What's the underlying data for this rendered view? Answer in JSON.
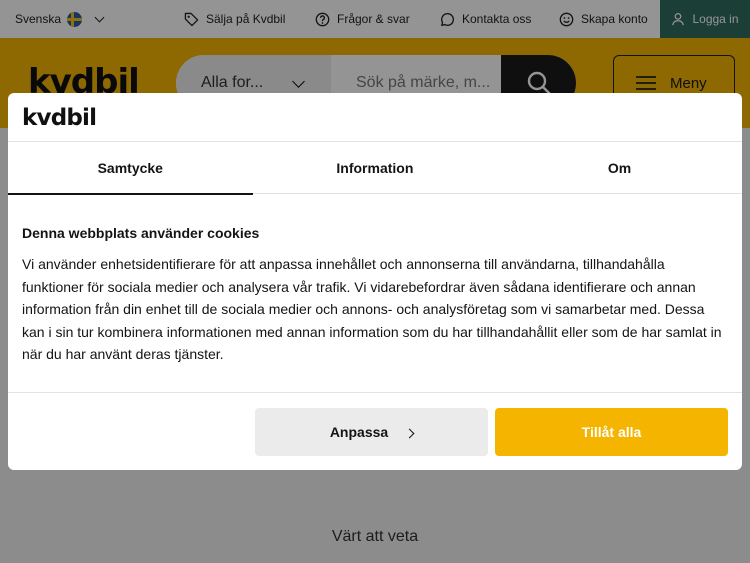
{
  "topbar": {
    "language": "Svenska",
    "sell_label": "Sälja på Kvdbil",
    "faq_label": "Frågor & svar",
    "contact_label": "Kontakta oss",
    "create_account_label": "Skapa konto",
    "login_label": "Logga in",
    "login_bg": "#2f6c5e"
  },
  "header": {
    "logo_text": "kvdbil",
    "category_select": "Alla for...",
    "search_placeholder": "Sök på märke, m...",
    "menu_label": "Meny",
    "brand_color": "#f4b400"
  },
  "page": {
    "section_heading": "Värt att veta"
  },
  "cookie_dialog": {
    "logo_text": "kvdbil",
    "tabs": [
      "Samtycke",
      "Information",
      "Om"
    ],
    "active_tab": "Samtycke",
    "title": "Denna webbplats använder cookies",
    "body": "Vi använder enhetsidentifierare för att anpassa innehållet och annonserna till användarna, tillhandahålla funktioner för sociala medier och analysera vår trafik. Vi vidarebefordrar även sådana identifierare och annan information från din enhet till de sociala medier och annons- och analysföretag som vi samarbetar med. Dessa kan i sin tur kombinera informationen med annan information som du har tillhandahållit eller som de har samlat in när du har använt deras tjänster.",
    "customize_label": "Anpassa",
    "allow_all_label": "Tillåt alla"
  }
}
